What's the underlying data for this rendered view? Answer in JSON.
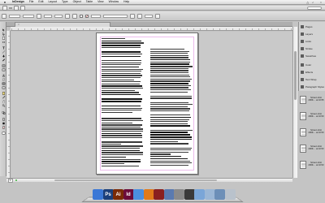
{
  "menubar": {
    "app_menu": "InDesign",
    "menus": [
      "File",
      "Edit",
      "Layout",
      "Type",
      "Object",
      "Table",
      "View",
      "Window",
      "Help"
    ],
    "clock": ""
  },
  "control": {
    "zoom": "",
    "workspace": ""
  },
  "document": {
    "tab_title": ""
  },
  "status": {
    "page": "1",
    "errors": ""
  },
  "right_panel": {
    "items": [
      {
        "label": "Pages",
        "icon": "pages-icon"
      },
      {
        "label": "Layers",
        "icon": "layers-icon"
      },
      {
        "label": "Links",
        "icon": "links-icon"
      },
      {
        "label": "Stroke",
        "icon": "stroke-icon"
      },
      {
        "label": "Swatches",
        "icon": "swatches-icon"
      },
      {
        "label": "Color",
        "icon": "color-icon"
      },
      {
        "label": "Effects",
        "icon": "effects-icon"
      },
      {
        "label": "Text Wrap",
        "icon": "text-wrap-icon"
      },
      {
        "label": "Paragraph Styles",
        "icon": "paragraph-styles-icon"
      }
    ]
  },
  "desktop_files": [
    {
      "name": "Screen shot 2009-... at 10.55"
    },
    {
      "name": "Screen shot 2009-... at 10.50"
    },
    {
      "name": "Screen shot 2009-... at 10.50"
    },
    {
      "name": "Screen shot 2009-... at 10.53"
    },
    {
      "name": "Screen shot 2009-... at 10.53"
    }
  ],
  "dock_apps": [
    {
      "name": "Finder",
      "label": "",
      "color": "#3b78d6"
    },
    {
      "name": "Photoshop",
      "label": "Ps",
      "color": "#1b3f7a"
    },
    {
      "name": "Illustrator",
      "label": "Ai",
      "color": "#7a2a06"
    },
    {
      "name": "InDesign",
      "label": "Id",
      "color": "#6b0b3a"
    },
    {
      "name": "Safari",
      "label": "",
      "color": "#4a8fe0"
    },
    {
      "name": "Firefox",
      "label": "",
      "color": "#e07a1a"
    },
    {
      "name": "Photo Booth",
      "label": "",
      "color": "#8a1f1f"
    },
    {
      "name": "iTunes",
      "label": "",
      "color": "#5a7ab0"
    },
    {
      "name": "System Preferences",
      "label": "",
      "color": "#8a8a8a"
    },
    {
      "name": "Font Book",
      "label": "",
      "color": "#3a3a3a"
    },
    {
      "name": "Preview",
      "label": "",
      "color": "#7aa6d8"
    },
    {
      "name": "Mail",
      "label": "",
      "color": "#9bb7d6"
    },
    {
      "name": "Documents",
      "label": "",
      "color": "#6c8fb8"
    },
    {
      "name": "Trash",
      "label": "",
      "color": "#b9c2cc"
    }
  ],
  "colors": {
    "pasteboard": "#c9c9c9",
    "page": "#ffffff",
    "text": "#3a3a3a"
  }
}
